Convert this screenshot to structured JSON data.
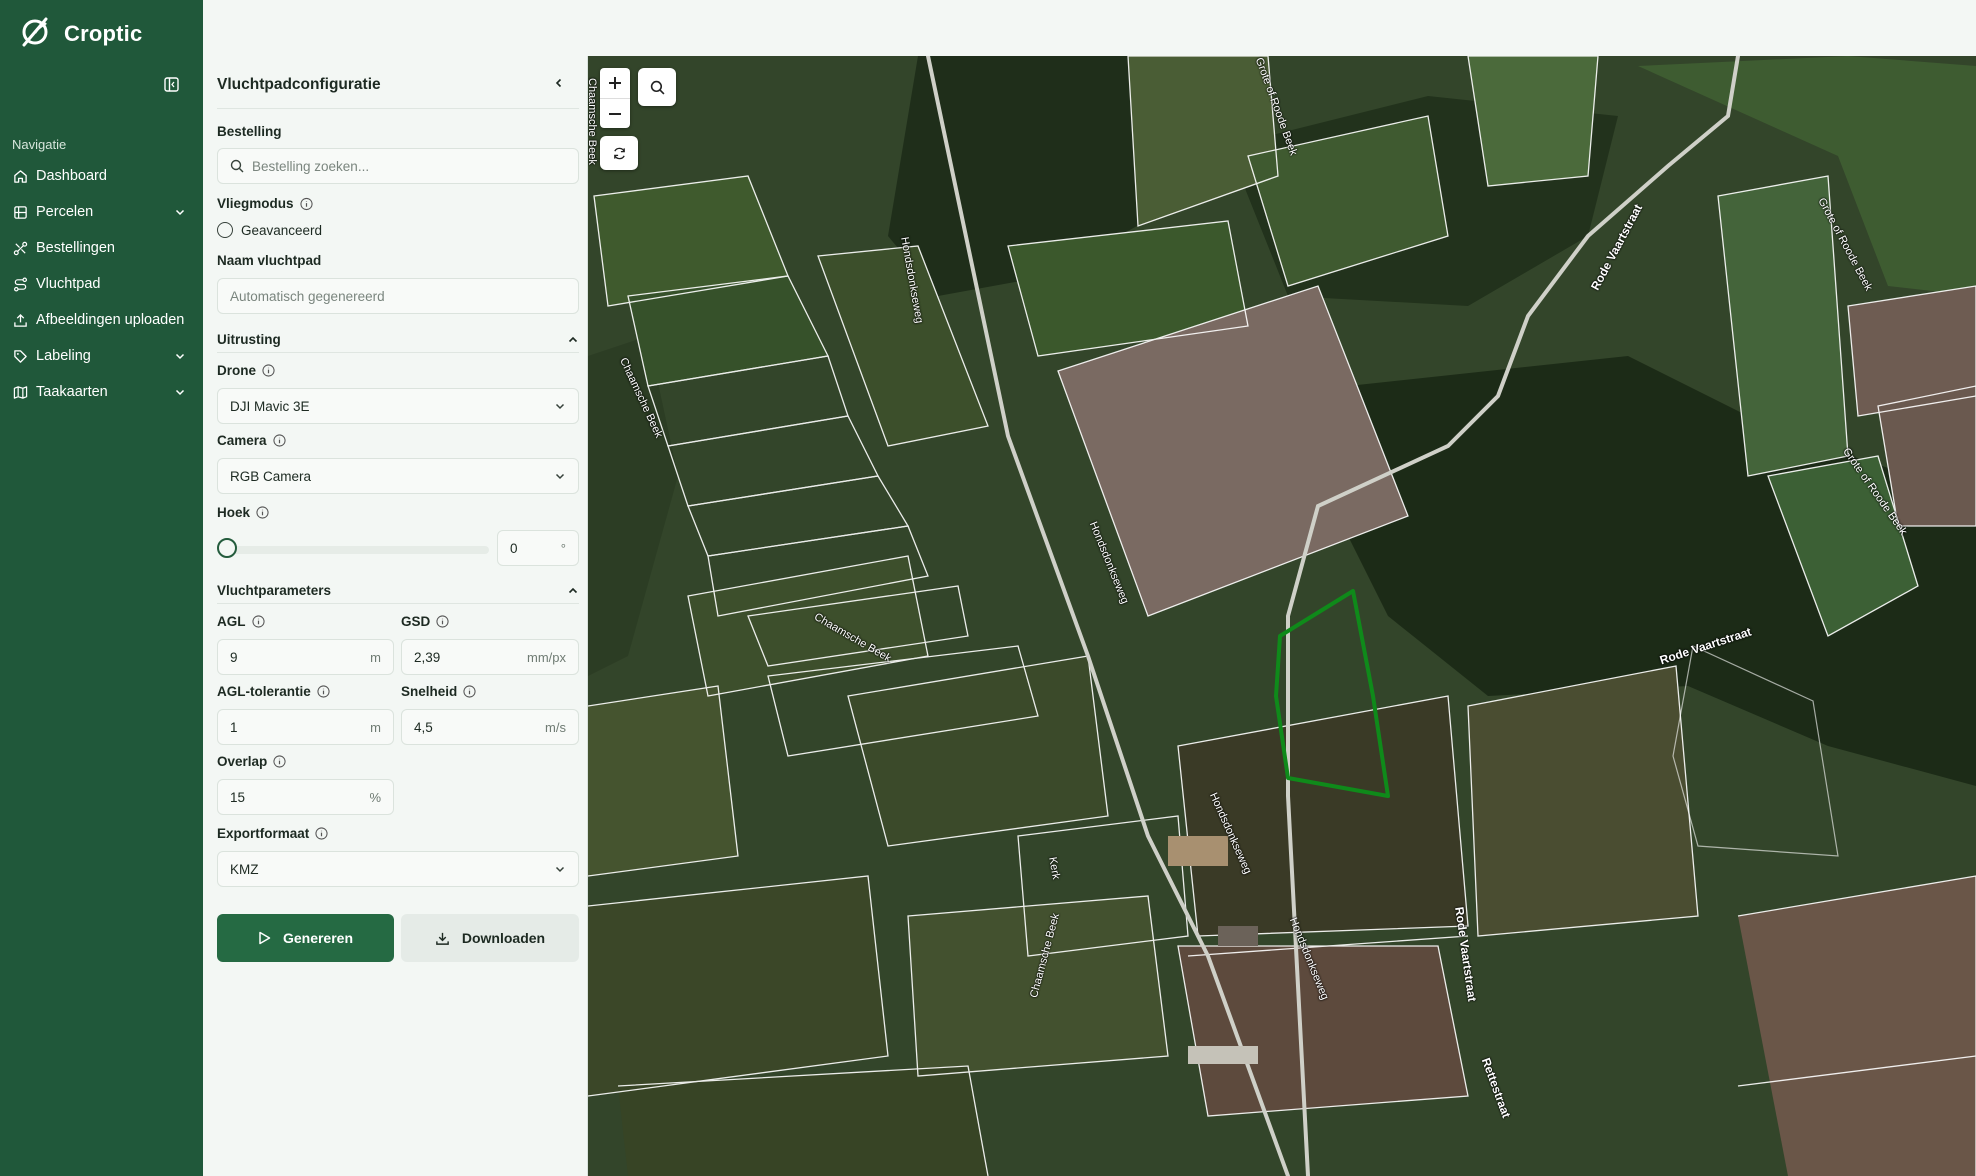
{
  "app": {
    "name": "Croptic",
    "accent": "#20583a",
    "button_green": "#256a43"
  },
  "sidebar": {
    "heading": "Navigatie",
    "items": [
      {
        "label": "Dashboard",
        "icon": "home-icon"
      },
      {
        "label": "Percelen",
        "icon": "map-icon",
        "expandable": true
      },
      {
        "label": "Bestellingen",
        "icon": "route-icon"
      },
      {
        "label": "Vluchtpad",
        "icon": "path-icon"
      },
      {
        "label": "Afbeeldingen uploaden",
        "icon": "upload-icon"
      },
      {
        "label": "Labeling",
        "icon": "tag-icon",
        "expandable": true
      },
      {
        "label": "Taakaarten",
        "icon": "map-icon",
        "expandable": true
      }
    ]
  },
  "panel": {
    "title": "Vluchtpadconfiguratie",
    "order_label": "Bestelling",
    "order_placeholder": "Bestelling zoeken...",
    "flymode_label": "Vliegmodus",
    "flymode_option": "Geavanceerd",
    "name_label": "Naam vluchtpad",
    "name_placeholder": "Automatisch gegenereerd",
    "equipment": {
      "title": "Uitrusting",
      "drone_label": "Drone",
      "drone_value": "DJI Mavic 3E",
      "camera_label": "Camera",
      "camera_value": "RGB Camera",
      "angle_label": "Hoek",
      "angle_value": "0",
      "angle_unit": "°"
    },
    "flight": {
      "title": "Vluchtparameters",
      "agl_label": "AGL",
      "agl_value": "9",
      "agl_unit": "m",
      "gsd_label": "GSD",
      "gsd_value": "2,39",
      "gsd_unit": "mm/px",
      "tol_label": "AGL-tolerantie",
      "tol_value": "1",
      "tol_unit": "m",
      "speed_label": "Snelheid",
      "speed_value": "4,5",
      "speed_unit": "m/s",
      "overlap_label": "Overlap",
      "overlap_value": "15",
      "overlap_unit": "%"
    },
    "export_label": "Exportformaat",
    "export_value": "KMZ",
    "generate_label": "Genereren",
    "download_label": "Downloaden"
  },
  "map": {
    "streets": [
      "Chaamsche Beek",
      "Chaamsche Beek",
      "Chaamsche Beek",
      "Chaamsche Beek",
      "Hondsdonkseweg",
      "Hondsdonkseweg",
      "Hondsdonkseweg",
      "Hondsdonkseweg",
      "Rode Vaartstraat",
      "Rode Vaartstraat",
      "Rode Vaartstraat",
      "Rettestraat",
      "Grote of Roode Beek",
      "Grote of Roode Beek",
      "Grote of Roode Beek",
      "Kerk"
    ],
    "selection_color": "#0f8a1a"
  }
}
